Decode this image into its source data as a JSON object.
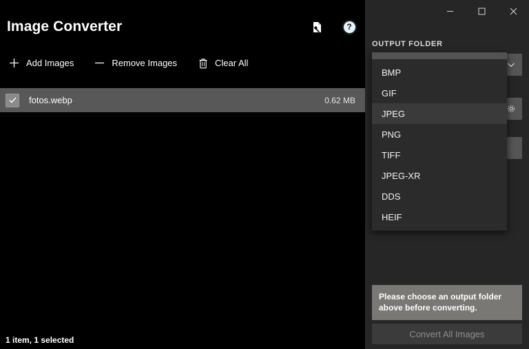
{
  "window": {
    "minimize_label": "–",
    "maximize_label": "□",
    "close_label": "✕"
  },
  "header": {
    "title": "Image Converter",
    "feedback_icon": "feedback-page-icon",
    "help_icon": "help-icon",
    "help_glyph": "?"
  },
  "toolbar": {
    "add_label": "Add Images",
    "remove_label": "Remove Images",
    "clear_label": "Clear All"
  },
  "file_list": {
    "rows": [
      {
        "name": "fotos.webp",
        "size": "0.62 MB",
        "checked": true
      }
    ]
  },
  "status": {
    "text": "1 item, 1 selected"
  },
  "output": {
    "section_label": "OUTPUT FOLDER",
    "folder_value": "",
    "folder_placeholder": "",
    "browse_icon": "chevron-down-icon",
    "quality_icon": "gear-icon",
    "extra_icon": "blank-icon"
  },
  "format_dropdown": {
    "options": [
      "BMP",
      "GIF",
      "JPEG",
      "PNG",
      "TIFF",
      "JPEG-XR",
      "DDS",
      "HEIF"
    ],
    "selected": "JPEG"
  },
  "footer": {
    "message": "Please choose an output folder above before converting.",
    "convert_label": "Convert All Images"
  },
  "colors": {
    "app_background": "#000000",
    "panel_background": "#262626",
    "row_selected": "#585858",
    "message_background": "#7a7875",
    "button_disabled": "#3b3b3b"
  }
}
